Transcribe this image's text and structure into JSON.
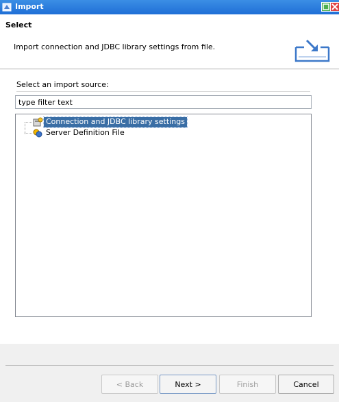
{
  "window": {
    "title": "Import",
    "icons": {
      "app": "import-wizard-icon",
      "maximize": "maximize-icon",
      "close": "close-icon"
    }
  },
  "banner": {
    "heading": "Select",
    "description": "Import connection and JDBC library settings from file.",
    "icon": "import-tray-icon"
  },
  "source": {
    "label": "Select an import source:",
    "filter_value": "type filter text",
    "items": [
      {
        "label": "Connection and JDBC library settings",
        "icon": "connection-settings-icon",
        "selected": true
      },
      {
        "label": "Server Definition File",
        "icon": "server-definition-icon",
        "selected": false
      }
    ]
  },
  "buttons": {
    "back": "< Back",
    "next": "Next >",
    "finish": "Finish",
    "cancel": "Cancel"
  },
  "colors": {
    "titlebar": "#1f6fd6",
    "selection": "#3a6ea5"
  }
}
